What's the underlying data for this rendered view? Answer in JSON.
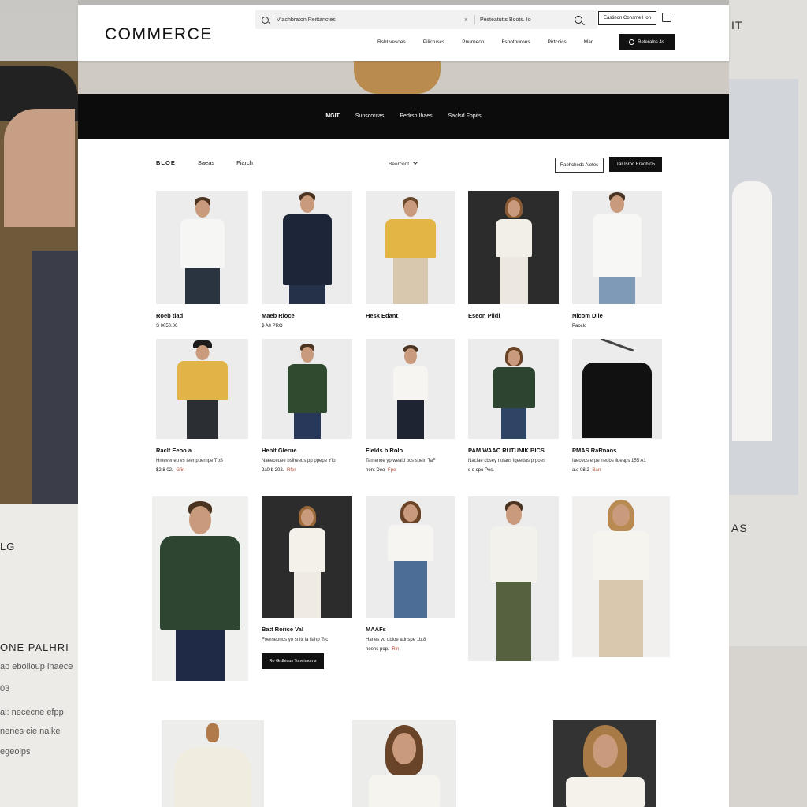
{
  "background": {
    "left_text_1": "LG",
    "left_text_2": "ONE PALHRI",
    "left_line_1": "ap ebolloup inaece",
    "left_line_2": "03",
    "left_line_3": "al: nececne efpp",
    "left_line_4": "nenes cie naike",
    "left_line_5": "egeolps",
    "right_text_1": "IT",
    "right_text_2": "AS"
  },
  "header": {
    "logo": "COMMERCE",
    "search_text": "Vtachbraton Reittanctes",
    "search_clear": "x",
    "search_text_2": "Pesteatutts Boots. Io",
    "top_button": "Eastinon Consme Hon",
    "nav": [
      "Rsht vesoes",
      "Pilicruscs",
      "Pnurneon",
      "Fsnotnurons",
      "Pirtccics",
      "Mar"
    ],
    "cta": "Reteralns 4s"
  },
  "categories": {
    "items": [
      "MGIT",
      "Sunscorcas",
      "Pedrsh Ihaes",
      "Saclsd Fopits"
    ]
  },
  "toolbar": {
    "filters": [
      "BLOE",
      "Saeas",
      "Fiarch"
    ],
    "sort": "Beercont",
    "outline_button": "Raehcheds Aletes",
    "dark_button": "Tar Isroc Eraoh 05"
  },
  "products_row1": [
    {
      "name": "Roeb tiad",
      "price": "S 0050.00"
    },
    {
      "name": "Maeb Rioce",
      "price": "$ A0 PRO"
    },
    {
      "name": "Hesk Edant",
      "price": ""
    },
    {
      "name": "Eseon Pildl",
      "price": ""
    },
    {
      "name": "Nicom Dile",
      "price": "Paoclo"
    }
  ],
  "products_row2": [
    {
      "name": "Raclt Eeoo a",
      "desc": "Hmeveneu vs teer ppernpe TbS",
      "price": "$2.8 02.",
      "sale": "Gfin"
    },
    {
      "name": "Heblt Glerue",
      "desc": "Naeeceuee bsiheeds pp ppepe Yfo",
      "price": "2a0 b 202.",
      "sale": "Rfer"
    },
    {
      "name": "Flelds b Rolo",
      "desc": "Tamenoe yp weald bcs speln TaF",
      "price": "nent Doo",
      "sale": "Fpe"
    },
    {
      "name": "PAM WAAC RUTUNIK BICS",
      "desc": "Naciae cbsey nolaus igeedas prpoes",
      "price": "s o spo Pes.",
      "sale": ""
    },
    {
      "name": "PMAS RaRnaos",
      "desc": "Iaeceos erpe neobs ildeaps 155 A1",
      "price": "a.e 08.2",
      "sale": "Ban"
    }
  ],
  "products_row3": {
    "center_name": "Batt Rorice Val",
    "center_desc": "Foerneonos yo snltr ia ilahp Tsc",
    "center_button": "Ro Grdhicus Toneimoms",
    "right_name": "MAAFs",
    "right_desc": "Hanes vo ubioe adnspe 1b.8",
    "right_price": "neens pop.",
    "right_sale": "Rin"
  }
}
